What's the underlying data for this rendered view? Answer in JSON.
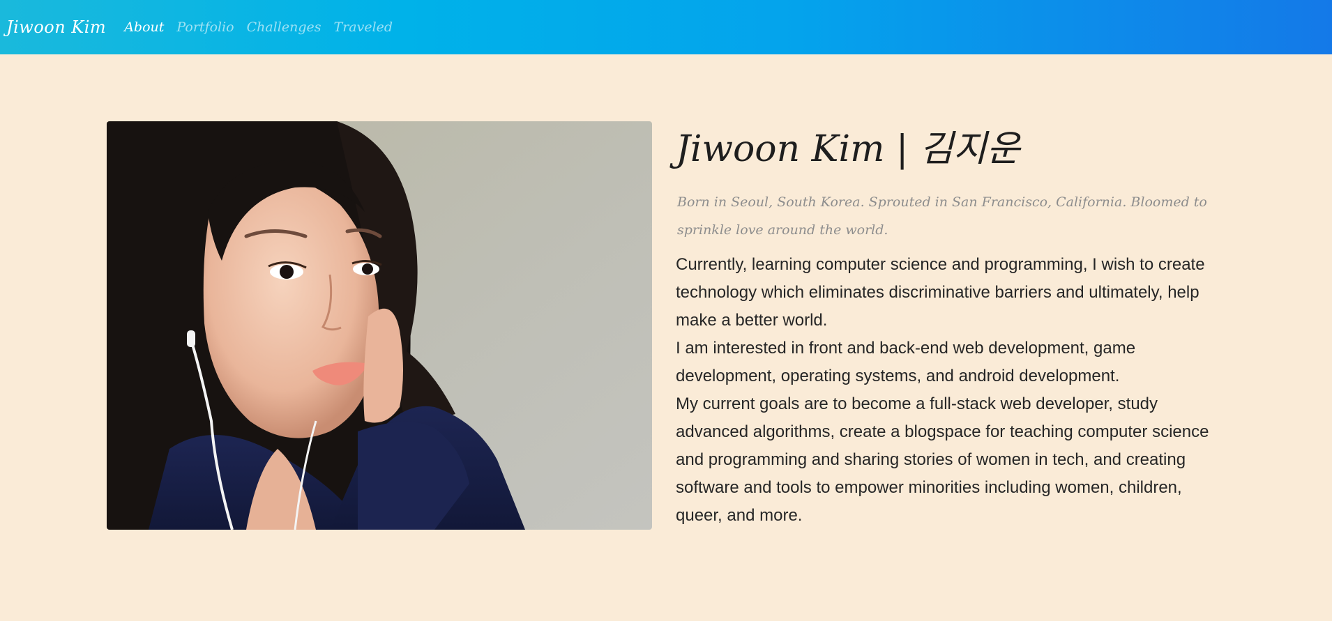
{
  "nav": {
    "brand": "Jiwoon Kim",
    "links": [
      {
        "label": "About",
        "active": true
      },
      {
        "label": "Portfolio",
        "active": false
      },
      {
        "label": "Challenges",
        "active": false
      },
      {
        "label": "Traveled",
        "active": false
      }
    ]
  },
  "profile": {
    "title": "Jiwoon Kim | 김지운",
    "subtitle": "Born in Seoul, South Korea. Sprouted in San Francisco, California. Bloomed to sprinkle love around the world.",
    "bio": [
      "Currently, learning computer science and programming, I wish to create technology which eliminates discriminative barriers and ultimately, help make a better world.",
      "I am interested in front and back-end web development, game development, operating systems, and android development.",
      "My current goals are to become a full-stack web developer, study advanced algorithms, create a blogspace for teaching computer science and programming and sharing stories of women in tech, and creating software and tools to empower minorities including women, children, queer, and more."
    ]
  },
  "colors": {
    "page_background": "#faebd7",
    "nav_gradient_start": "#1ab9dc",
    "nav_gradient_end": "#1479e8",
    "title_text": "#1e1e1e",
    "subtitle_text": "#8d8d8d",
    "body_text": "#262626"
  }
}
